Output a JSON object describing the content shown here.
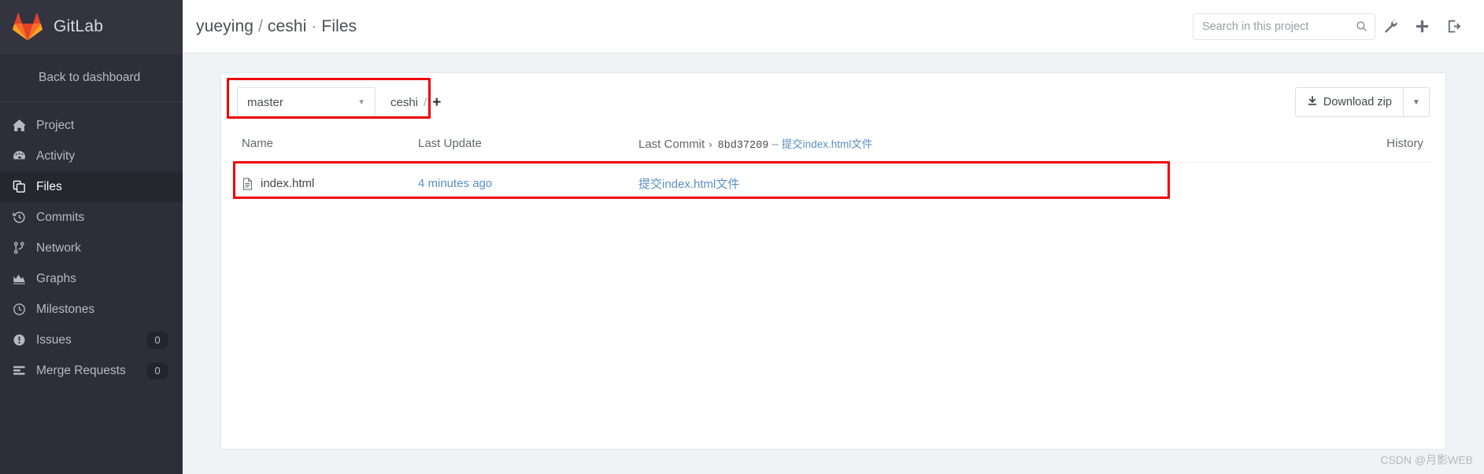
{
  "sidebar": {
    "brand": {
      "name": "GitLab",
      "logo_icon": "gitlab-tanuki-logo"
    },
    "back_to_dashboard": "Back to dashboard",
    "items": [
      {
        "label": "Project",
        "icon": "home-icon",
        "badge": "",
        "active": false
      },
      {
        "label": "Activity",
        "icon": "dashboard-icon",
        "badge": "",
        "active": false
      },
      {
        "label": "Files",
        "icon": "files-icon",
        "badge": "",
        "active": true
      },
      {
        "label": "Commits",
        "icon": "history-icon",
        "badge": "",
        "active": false
      },
      {
        "label": "Network",
        "icon": "branch-icon",
        "badge": "",
        "active": false
      },
      {
        "label": "Graphs",
        "icon": "chart-area-icon",
        "badge": "",
        "active": false
      },
      {
        "label": "Milestones",
        "icon": "clock-icon",
        "badge": "",
        "active": false
      },
      {
        "label": "Issues",
        "icon": "exclamation-circle-icon",
        "badge": "0",
        "active": false
      },
      {
        "label": "Merge Requests",
        "icon": "merge-request-icon",
        "badge": "0",
        "active": false
      }
    ]
  },
  "topbar": {
    "namespace": "yueying",
    "separator_slash": "/",
    "project": "ceshi",
    "separator_dot": "·",
    "section": "Files",
    "title_full": "yueying / ceshi · Files",
    "search": {
      "placeholder": "Search in this project",
      "value": "",
      "icon": "search-icon"
    },
    "actions": [
      {
        "name": "wrench-icon",
        "glyph": "wrench"
      },
      {
        "name": "plus-icon",
        "glyph": "plus"
      },
      {
        "name": "sign-out-icon",
        "glyph": "sign-out"
      }
    ]
  },
  "tree_controls": {
    "branch": {
      "value": "master",
      "caret_icon": "chevron-down-icon"
    },
    "path_crumbs": [
      "ceshi"
    ],
    "path_slash": "/",
    "add_button": "+",
    "download": {
      "label": "Download zip",
      "icon": "download-icon",
      "caret_icon": "chevron-down-icon"
    }
  },
  "file_table": {
    "columns": {
      "name": "Name",
      "last_update": "Last Update",
      "last_commit": "Last Commit",
      "history": "History"
    },
    "head_commit": {
      "chevron": "›",
      "sha": "8bd37209",
      "dash": "–",
      "message": "提交index.html文件"
    },
    "rows": [
      {
        "icon": "file-text-icon",
        "name": "index.html",
        "last_update": "4 minutes ago",
        "last_commit_message": "提交index.html文件"
      }
    ]
  },
  "annotations": {
    "highlight_color": "#ef0000",
    "boxes": [
      "branch-selector-highlight",
      "file-row-highlight"
    ]
  },
  "watermark": {
    "text": "CSDN @月影WEB"
  },
  "colors": {
    "sidebar_bg": "#2e2e39",
    "sidebar_active": "#26262f",
    "link_blue": "#5a8fc7",
    "page_bg": "#f0f2f5",
    "annotation_red": "#ef0000"
  }
}
